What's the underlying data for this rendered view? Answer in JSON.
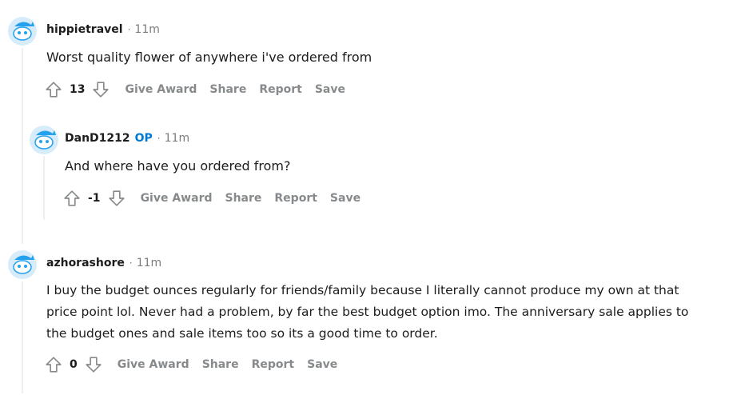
{
  "comments": [
    {
      "author": "hippietravel",
      "op_badge": "",
      "time": "11m",
      "text": "Worst quality flower of anywhere i've ordered from",
      "score": "13",
      "actions": {
        "award": "Give Award",
        "share": "Share",
        "report": "Report",
        "save": "Save"
      }
    },
    {
      "author": "DanD1212",
      "op_badge": "OP",
      "time": "11m",
      "text": "And where have you ordered from?",
      "score": "-1",
      "actions": {
        "award": "Give Award",
        "share": "Share",
        "report": "Report",
        "save": "Save"
      }
    },
    {
      "author": "azhorashore",
      "op_badge": "",
      "time": "11m",
      "text": "I buy the budget ounces regularly for friends/family because I literally cannot produce my own at that price point lol. Never had a problem, by far the best budget option imo. The anniversary sale applies to the budget ones and sale items too so its a good time to order.",
      "score": "0",
      "actions": {
        "award": "Give Award",
        "share": "Share",
        "report": "Report",
        "save": "Save"
      }
    }
  ],
  "separator": "·",
  "colors": {
    "accent": "#0079d3",
    "muted": "#878a8c",
    "avatar_bg": "#d7ecfb",
    "avatar_blue": "#24a0ed"
  },
  "icons": {
    "avatar": "snoo-avatar-icon",
    "upvote": "upvote-arrow-icon",
    "downvote": "downvote-arrow-icon"
  }
}
